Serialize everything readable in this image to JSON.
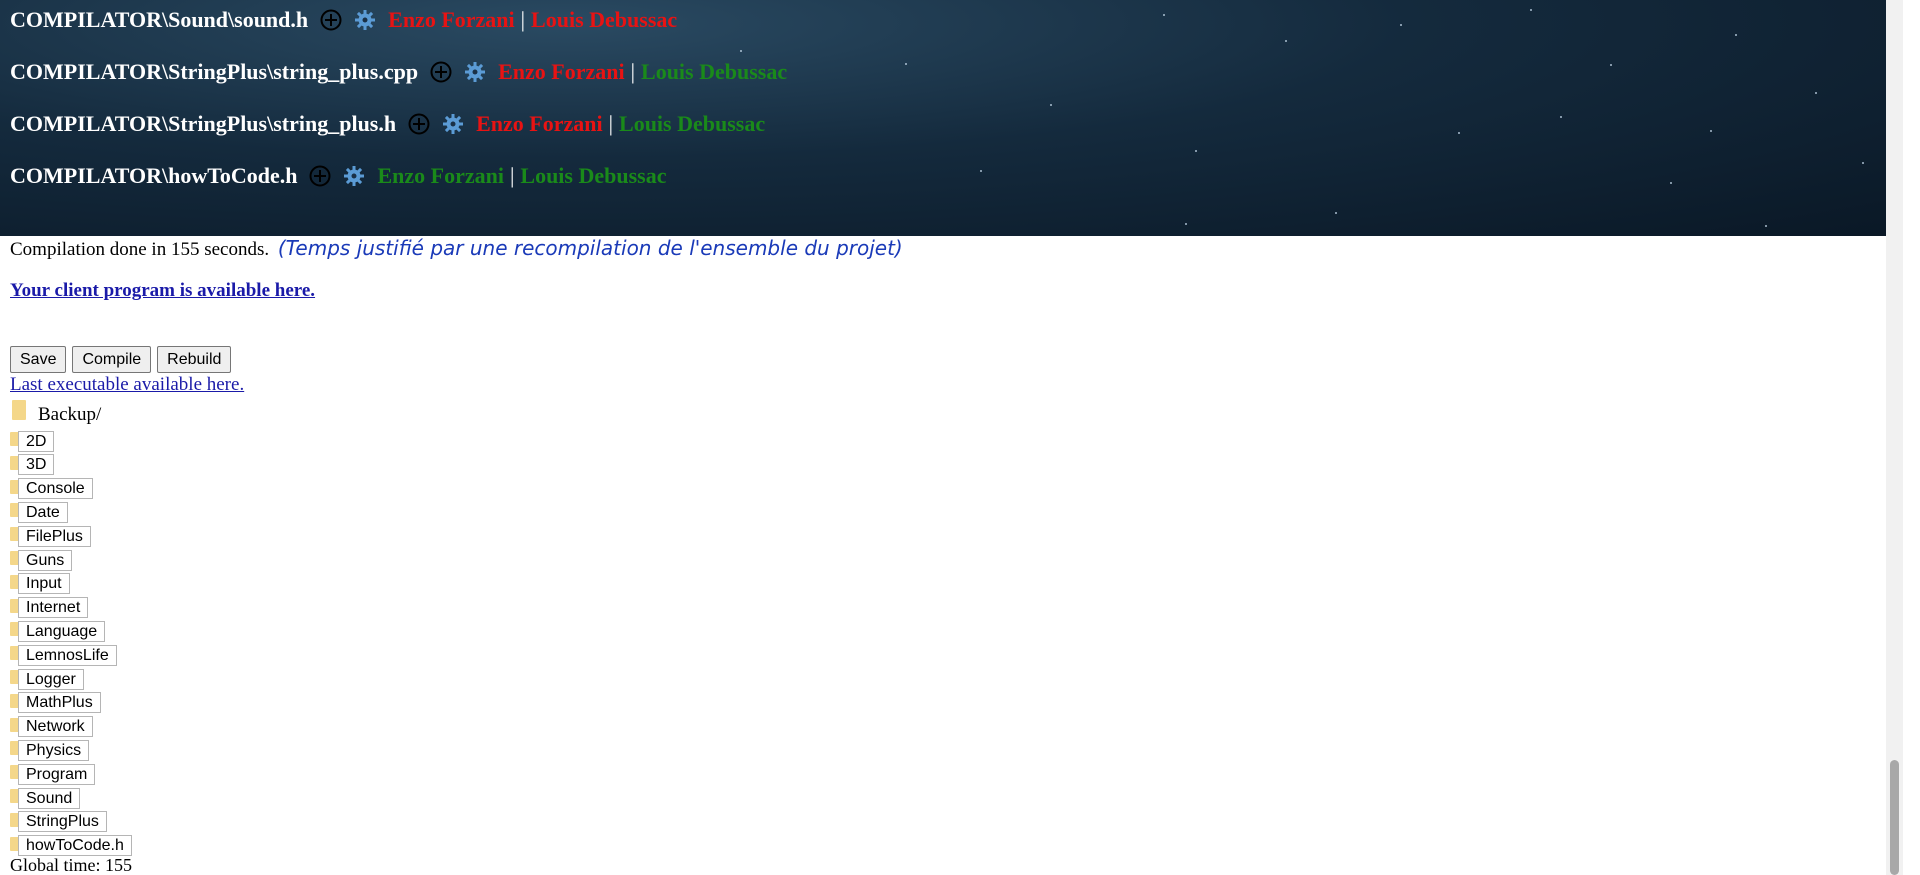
{
  "files": [
    {
      "path": "COMPILATOR\\Sound\\sound.h",
      "author1": "Enzo Forzani",
      "author1_color": "#e81313",
      "author2": "Louis Debussac",
      "author2_color": "#e81313"
    },
    {
      "path": "COMPILATOR\\StringPlus\\string_plus.cpp",
      "author1": "Enzo Forzani",
      "author1_color": "#e81313",
      "author2": "Louis Debussac",
      "author2_color": "#1a8a1a"
    },
    {
      "path": "COMPILATOR\\StringPlus\\string_plus.h",
      "author1": "Enzo Forzani",
      "author1_color": "#e81313",
      "author2": "Louis Debussac",
      "author2_color": "#1a8a1a"
    },
    {
      "path": "COMPILATOR\\howToCode.h",
      "author1": "Enzo Forzani",
      "author1_color": "#1a8a1a",
      "author2": "Louis Debussac",
      "author2_color": "#1a8a1a"
    }
  ],
  "separator": "|",
  "status": {
    "text": "Compilation done in 155 seconds.",
    "note": "(Temps justifié par une recompilation de l'ensemble du projet)"
  },
  "client_link": "Your client program is available here.",
  "buttons": {
    "save": "Save",
    "compile": "Compile",
    "rebuild": "Rebuild"
  },
  "exe_link": "Last executable available here.",
  "backup_label": "Backup/",
  "folders": [
    "2D",
    "3D",
    "Console",
    "Date",
    "FilePlus",
    "Guns",
    "Input",
    "Internet",
    "Language",
    "LemnosLife",
    "Logger",
    "MathPlus",
    "Network",
    "Physics",
    "Program",
    "Sound",
    "StringPlus",
    "howToCode.h"
  ],
  "global_time": "Global time: 155",
  "icons": {
    "add": "plus-circle-icon",
    "settings": "gear-icon",
    "folder": "folder-icon"
  },
  "colors": {
    "red": "#e81313",
    "green": "#1a8a1a",
    "link": "#1a1aa8",
    "note": "#1a3ab8",
    "folder": "#f4d78a"
  }
}
